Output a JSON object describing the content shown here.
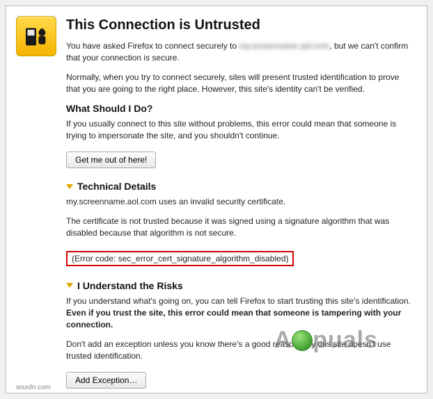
{
  "title": "This Connection is Untrusted",
  "intro_a": "You have asked Firefox to connect securely to ",
  "intro_site_blurred": "my.screenname.aol.com",
  "intro_b": ", but we can't confirm that your connection is secure.",
  "normally_para": "Normally, when you try to connect securely, sites will present trusted identification to prove that you are going to the right place. However, this site's identity can't be verified.",
  "what_heading": "What Should I Do?",
  "what_para": "If you usually connect to this site without problems, this error could mean that someone is trying to impersonate the site, and you shouldn't continue.",
  "get_out_label": "Get me out of here!",
  "tech_heading": "Technical Details",
  "tech_para_1": "my.screenname.aol.com uses an invalid security certificate.",
  "tech_para_2": "The certificate is not trusted because it was signed using a signature algorithm that was disabled because that algorithm is not secure.",
  "error_code": "(Error code: sec_error_cert_signature_algorithm_disabled)",
  "risks_heading": "I Understand the Risks",
  "risks_para_a": "If you understand what's going on, you can tell Firefox to start trusting this site's identification. ",
  "risks_para_b_strong": "Even if you trust the site, this error could mean that someone is tampering with your connection.",
  "risks_para_2": "Don't add an exception unless you know there's a good reason why this site doesn't use trusted identification.",
  "add_exception_label": "Add Exception…",
  "watermark_a": "A",
  "watermark_c": "puals",
  "wm_url": "wsxdn.com"
}
